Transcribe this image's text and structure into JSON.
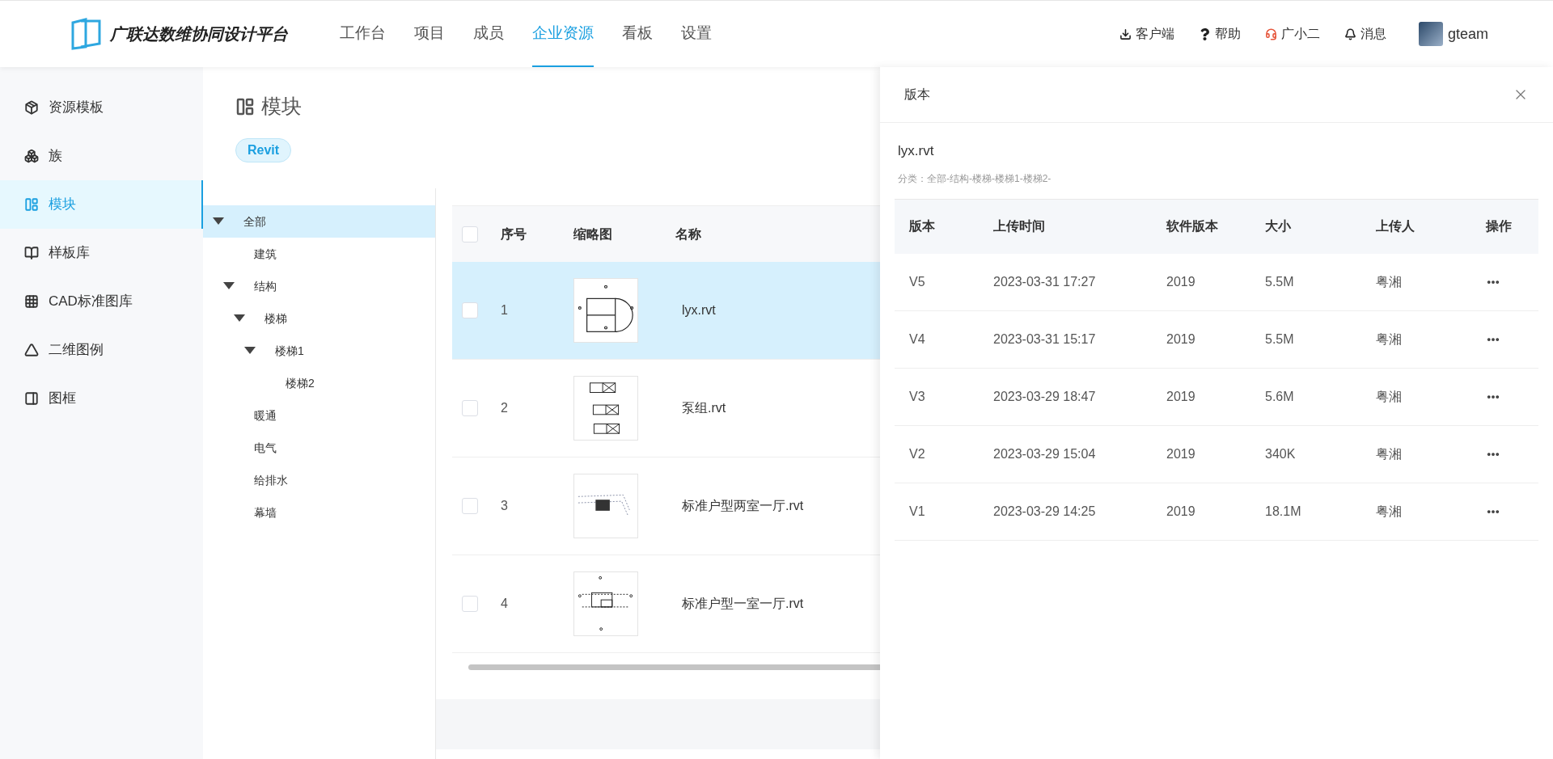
{
  "header": {
    "logo_text": "广联达数维协同设计平台",
    "nav": [
      {
        "label": "工作台",
        "selected": false
      },
      {
        "label": "项目",
        "selected": false
      },
      {
        "label": "成员",
        "selected": false
      },
      {
        "label": "企业资源",
        "selected": true
      },
      {
        "label": "看板",
        "selected": false
      },
      {
        "label": "设置",
        "selected": false
      }
    ],
    "actions": [
      {
        "kind": "download",
        "label": "客户端"
      },
      {
        "kind": "help",
        "label": "帮助"
      },
      {
        "kind": "support",
        "label": "广小二"
      },
      {
        "kind": "bell",
        "label": "消息"
      }
    ],
    "user": {
      "name": "gteam"
    }
  },
  "sidebar": {
    "items": [
      {
        "kind": "template",
        "label": "资源模板",
        "selected": false
      },
      {
        "kind": "family",
        "label": "族",
        "selected": false
      },
      {
        "kind": "module",
        "label": "模块",
        "selected": true
      },
      {
        "kind": "sample",
        "label": "样板库",
        "selected": false
      },
      {
        "kind": "cad",
        "label": "CAD标准图库",
        "selected": false
      },
      {
        "kind": "legend",
        "label": "二维图例",
        "selected": false
      },
      {
        "kind": "frame",
        "label": "图框",
        "selected": false
      }
    ]
  },
  "page": {
    "title": "模块",
    "tag": "Revit"
  },
  "tree": [
    {
      "label": "全部",
      "selected": true,
      "expanded": true,
      "children": [
        {
          "label": "建筑",
          "selected": false
        },
        {
          "label": "结构",
          "selected": false,
          "expanded": true,
          "children": [
            {
              "label": "楼梯",
              "selected": false,
              "expanded": true,
              "children": [
                {
                  "label": "楼梯1",
                  "selected": false,
                  "expanded": true,
                  "children": [
                    {
                      "label": "楼梯2",
                      "selected": false
                    }
                  ]
                }
              ]
            }
          ]
        },
        {
          "label": "暖通",
          "selected": false
        },
        {
          "label": "电气",
          "selected": false
        },
        {
          "label": "给排水",
          "selected": false
        },
        {
          "label": "幕墙",
          "selected": false
        }
      ]
    }
  ],
  "table": {
    "select_all_checked": false,
    "columns": [
      "序号",
      "缩略图",
      "名称"
    ],
    "rows": [
      {
        "index": "1",
        "kind": "plan",
        "name": "lyx.rvt",
        "selected": true,
        "checked": false
      },
      {
        "index": "2",
        "kind": "pumps",
        "name": "泵组.rvt",
        "selected": false,
        "checked": false
      },
      {
        "index": "3",
        "kind": "model",
        "name": "标准户型两室一厅.rvt",
        "selected": false,
        "checked": false
      },
      {
        "index": "4",
        "kind": "floorplan",
        "name": "标准户型一室一厅.rvt",
        "selected": false,
        "checked": false
      }
    ]
  },
  "drawer": {
    "title": "版本",
    "file_name": "lyx.rvt",
    "category": "分类：全部-结构-楼梯-楼梯1-楼梯2-",
    "columns": [
      "版本",
      "上传时间",
      "软件版本",
      "大小",
      "上传人",
      "操作"
    ],
    "rows": [
      {
        "version": "V5",
        "time": "2023-03-31 17:27",
        "software": "2019",
        "size": "5.5M",
        "uploader": "粤湘"
      },
      {
        "version": "V4",
        "time": "2023-03-31 15:17",
        "software": "2019",
        "size": "5.5M",
        "uploader": "粤湘"
      },
      {
        "version": "V3",
        "time": "2023-03-29 18:47",
        "software": "2019",
        "size": "5.6M",
        "uploader": "粤湘"
      },
      {
        "version": "V2",
        "time": "2023-03-29 15:04",
        "software": "2019",
        "size": "340K",
        "uploader": "粤湘"
      },
      {
        "version": "V1",
        "time": "2023-03-29 14:25",
        "software": "2019",
        "size": "18.1M",
        "uploader": "粤湘"
      }
    ]
  }
}
